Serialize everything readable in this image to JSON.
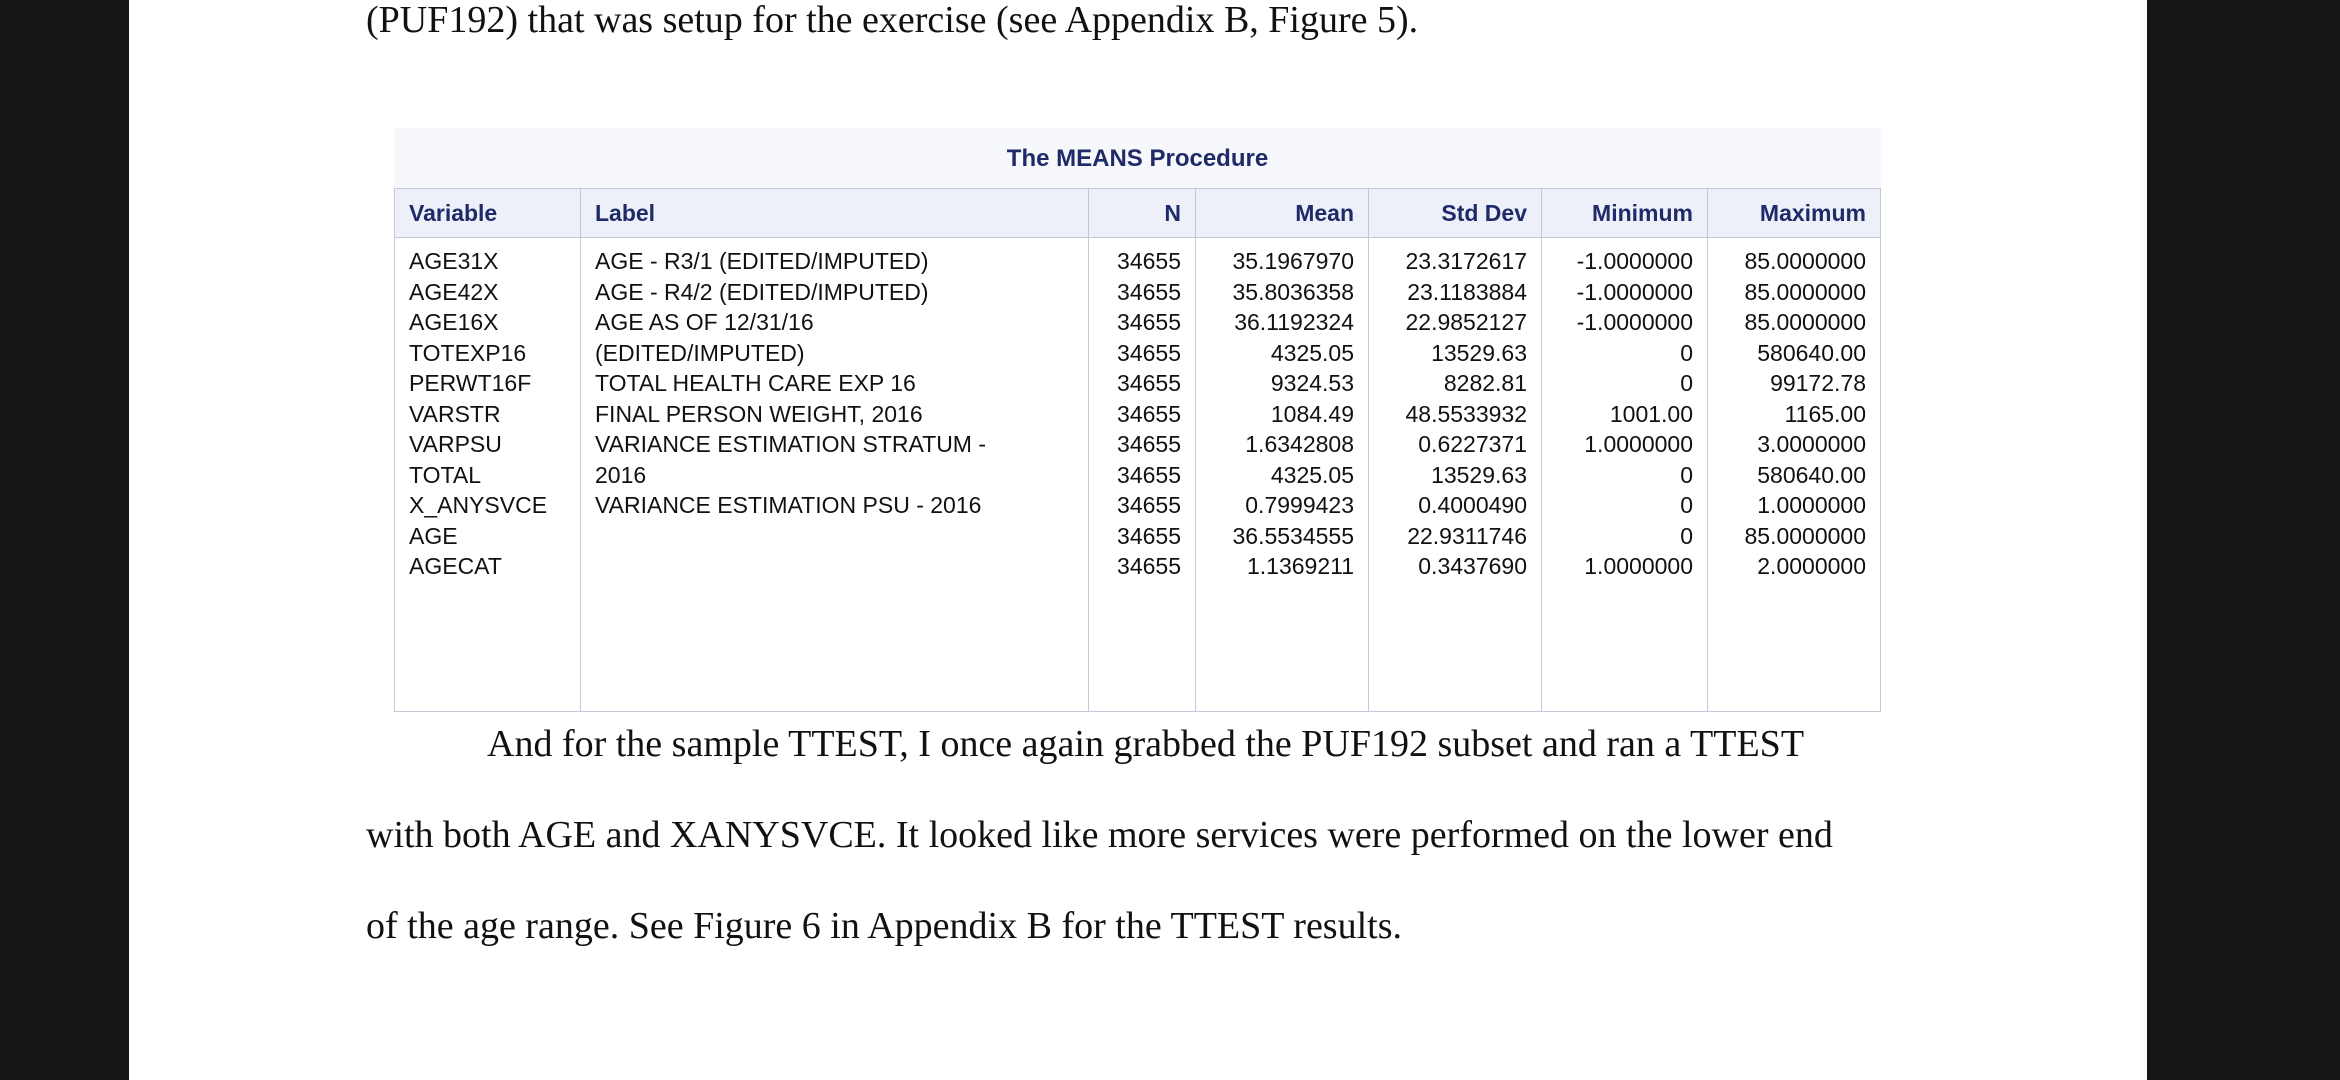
{
  "document": {
    "top_text": "(PUF192) that was setup for the exercise (see Appendix B, Figure 5).",
    "paragraph_lines": [
      "And for the sample TTEST, I once again grabbed the PUF192 subset and ran a TTEST",
      "with both AGE and XANYSVCE. It looked like more services were performed on the lower end",
      "of the age range. See Figure 6 in Appendix B for the TTEST results."
    ]
  },
  "sas_output": {
    "title": "The MEANS Procedure",
    "headers": [
      "Variable",
      "Label",
      "N",
      "Mean",
      "Std Dev",
      "Minimum",
      "Maximum"
    ],
    "columns": {
      "variable": [
        "AGE31X",
        "AGE42X",
        "AGE16X",
        "TOTEXP16",
        "PERWT16F",
        "VARSTR",
        "VARPSU",
        "TOTAL",
        "X_ANYSVCE",
        "AGE",
        "AGECAT"
      ],
      "label": [
        "AGE - R3/1 (EDITED/IMPUTED)",
        "AGE - R4/2 (EDITED/IMPUTED)",
        "AGE AS OF 12/31/16",
        "(EDITED/IMPUTED)",
        "TOTAL HEALTH CARE EXP 16",
        "FINAL PERSON WEIGHT, 2016",
        "VARIANCE ESTIMATION STRATUM -",
        "2016",
        "VARIANCE ESTIMATION PSU - 2016"
      ],
      "n": [
        "34655",
        "34655",
        "34655",
        "34655",
        "34655",
        "34655",
        "34655",
        "34655",
        "34655",
        "34655",
        "34655"
      ],
      "mean": [
        "35.1967970",
        "35.8036358",
        "36.1192324",
        "4325.05",
        "9324.53",
        "1084.49",
        "1.6342808",
        "4325.05",
        "0.7999423",
        "36.5534555",
        "1.1369211"
      ],
      "std_dev": [
        "23.3172617",
        "23.1183884",
        "22.9852127",
        "13529.63",
        "8282.81",
        "48.5533932",
        "0.6227371",
        "13529.63",
        "0.4000490",
        "22.9311746",
        "0.3437690"
      ],
      "minimum": [
        "-1.0000000",
        "-1.0000000",
        "-1.0000000",
        "0",
        "0",
        "1001.00",
        "1.0000000",
        "0",
        "0",
        "0",
        "1.0000000"
      ],
      "maximum": [
        "85.0000000",
        "85.0000000",
        "85.0000000",
        "580640.00",
        "99172.78",
        "1165.00",
        "3.0000000",
        "580640.00",
        "1.0000000",
        "85.0000000",
        "2.0000000"
      ]
    }
  }
}
